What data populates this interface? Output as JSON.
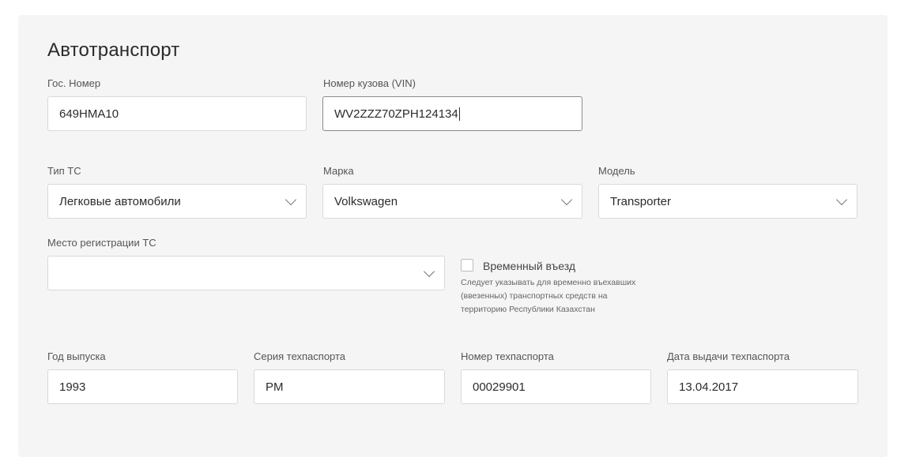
{
  "section": {
    "title": "Автотранспорт"
  },
  "fields": {
    "gos_nomer": {
      "label": "Гос. Номер",
      "value": "649HMA10"
    },
    "vin": {
      "label": "Номер кузова (VIN)",
      "value": "WV2ZZZ70ZPH124134"
    },
    "tip_ts": {
      "label": "Тип ТС",
      "value": "Легковые автомобили"
    },
    "marka": {
      "label": "Марка",
      "value": "Volkswagen"
    },
    "model": {
      "label": "Модель",
      "value": "Transporter"
    },
    "mesto_reg": {
      "label": "Место регистрации ТС",
      "value": ""
    },
    "god": {
      "label": "Год выпуска",
      "value": "1993"
    },
    "seriya": {
      "label": "Серия техпаспорта",
      "value": "PM"
    },
    "nomer_tp": {
      "label": "Номер техпаспорта",
      "value": "00029901"
    },
    "data_tp": {
      "label": "Дата выдачи техпаспорта",
      "value": "13.04.2017"
    }
  },
  "temporary_entry": {
    "label": "Временный въезд",
    "checked": false,
    "hint": "Следует указывать для временно въехавших (ввезенных) транспортных средств на территорию Республики Казахстан"
  },
  "icons": {
    "select_arrow": "chevron-down-icon"
  },
  "colors": {
    "panel_bg": "#f5f5f5",
    "field_border": "#d9d9d9",
    "active_border": "#8a8a8a"
  }
}
